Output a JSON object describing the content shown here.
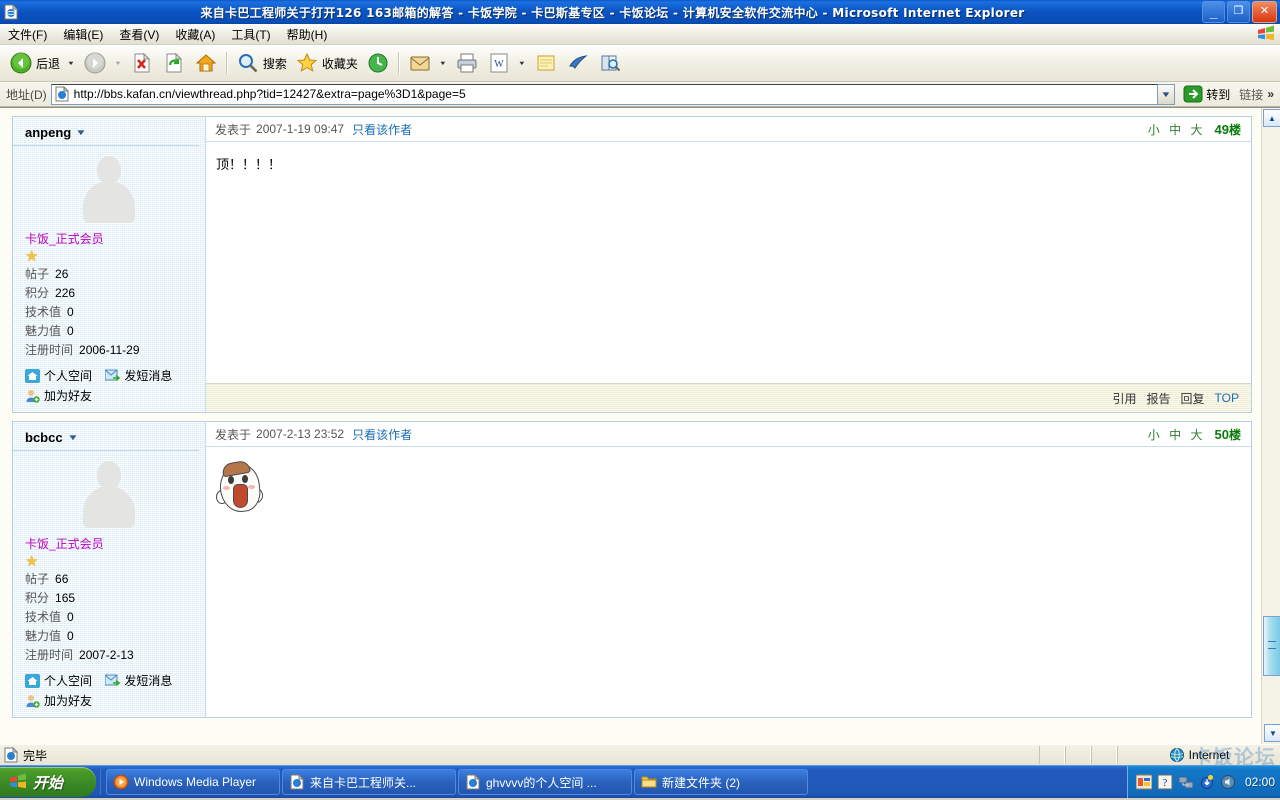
{
  "window": {
    "title": "来自卡巴工程师关于打开126 163邮箱的解答 - 卡饭学院 - 卡巴斯基专区 - 卡饭论坛 - 计算机安全软件交流中心 - Microsoft Internet Explorer",
    "icon": "ie-document-icon",
    "minimize": "_",
    "maximize": "❐",
    "close": "✕"
  },
  "menubar": {
    "items": [
      {
        "label": "文件(F)",
        "name": "menu-file"
      },
      {
        "label": "编辑(E)",
        "name": "menu-edit"
      },
      {
        "label": "查看(V)",
        "name": "menu-view"
      },
      {
        "label": "收藏(A)",
        "name": "menu-favorites"
      },
      {
        "label": "工具(T)",
        "name": "menu-tools"
      },
      {
        "label": "帮助(H)",
        "name": "menu-help"
      }
    ]
  },
  "toolbar": {
    "back_label": "后退",
    "search_label": "搜索",
    "favorites_label": "收藏夹",
    "dropdown_arrow": "▼"
  },
  "addressbar": {
    "label": "地址(D)",
    "url": "http://bbs.kafan.cn/viewthread.php?tid=12427&extra=page%3D1&page=5",
    "dropdown_arrow": "▼",
    "go_label": "转到",
    "links_label": "链接",
    "chevron": "»"
  },
  "posts": [
    {
      "user": {
        "name": "anpeng",
        "caret": "▼",
        "group_title": "卡饭_正式会员",
        "stars": "★",
        "stats": [
          {
            "label": "帖子",
            "value": "26"
          },
          {
            "label": "积分",
            "value": "226"
          },
          {
            "label": "技术值",
            "value": "0"
          },
          {
            "label": "魅力值",
            "value": "0"
          },
          {
            "label": "注册时间",
            "value": "2006-11-29"
          }
        ],
        "links": [
          {
            "label": "个人空间",
            "icon": "home-icon"
          },
          {
            "label": "发短消息",
            "icon": "message-icon"
          },
          {
            "label": "加为好友",
            "icon": "add-friend-icon"
          }
        ]
      },
      "header": {
        "posted_label": "发表于",
        "datetime": "2007-1-19 09:47",
        "only_author": "只看该作者",
        "sizes": [
          "小",
          "中",
          "大"
        ],
        "floor_number": "49",
        "floor_unit": "楼"
      },
      "body_text": "顶！！！！",
      "has_emoticon": false,
      "footer": [
        {
          "label": "引用",
          "name": "quote-link"
        },
        {
          "label": "报告",
          "name": "report-link"
        },
        {
          "label": "回复",
          "name": "reply-link"
        },
        {
          "label": "TOP",
          "name": "top-link"
        }
      ]
    },
    {
      "user": {
        "name": "bcbcc",
        "caret": "▼",
        "group_title": "卡饭_正式会员",
        "stars": "★",
        "stats": [
          {
            "label": "帖子",
            "value": "66"
          },
          {
            "label": "积分",
            "value": "165"
          },
          {
            "label": "技术值",
            "value": "0"
          },
          {
            "label": "魅力值",
            "value": "0"
          },
          {
            "label": "注册时间",
            "value": "2007-2-13"
          }
        ],
        "links": [
          {
            "label": "个人空间",
            "icon": "home-icon"
          },
          {
            "label": "发短消息",
            "icon": "message-icon"
          },
          {
            "label": "加为好友",
            "icon": "add-friend-icon"
          }
        ]
      },
      "header": {
        "posted_label": "发表于",
        "datetime": "2007-2-13 23:52",
        "only_author": "只看该作者",
        "sizes": [
          "小",
          "中",
          "大"
        ],
        "floor_number": "50",
        "floor_unit": "楼"
      },
      "body_text": "",
      "has_emoticon": true,
      "footer": [
        {
          "label": "引用",
          "name": "quote-link"
        },
        {
          "label": "报告",
          "name": "report-link"
        },
        {
          "label": "回复",
          "name": "reply-link"
        },
        {
          "label": "TOP",
          "name": "top-link"
        }
      ]
    }
  ],
  "scrollbar": {
    "up": "▲",
    "down": "▼"
  },
  "statusbar": {
    "text": "完毕",
    "zone": "Internet",
    "watermark": "卡饭论坛"
  },
  "taskbar": {
    "start_label": "开始",
    "tasks": [
      {
        "label": "Windows Media Player",
        "icon": "media-player-icon"
      },
      {
        "label": "来自卡巴工程师关...",
        "icon": "ie-document-icon"
      },
      {
        "label": "ghvvvv的个人空间 ...",
        "icon": "ie-document-icon"
      },
      {
        "label": "新建文件夹 (2)",
        "icon": "folder-icon"
      }
    ],
    "clock": "02:00"
  },
  "colors": {
    "title_blue": "#0a52c0",
    "close_red": "#d8360d",
    "link_blue": "#1a6db5",
    "group_magenta": "#c000c0",
    "floor_green": "#0a7a0a",
    "size_green": "#2f7f34",
    "start_green": "#3b8a25"
  }
}
